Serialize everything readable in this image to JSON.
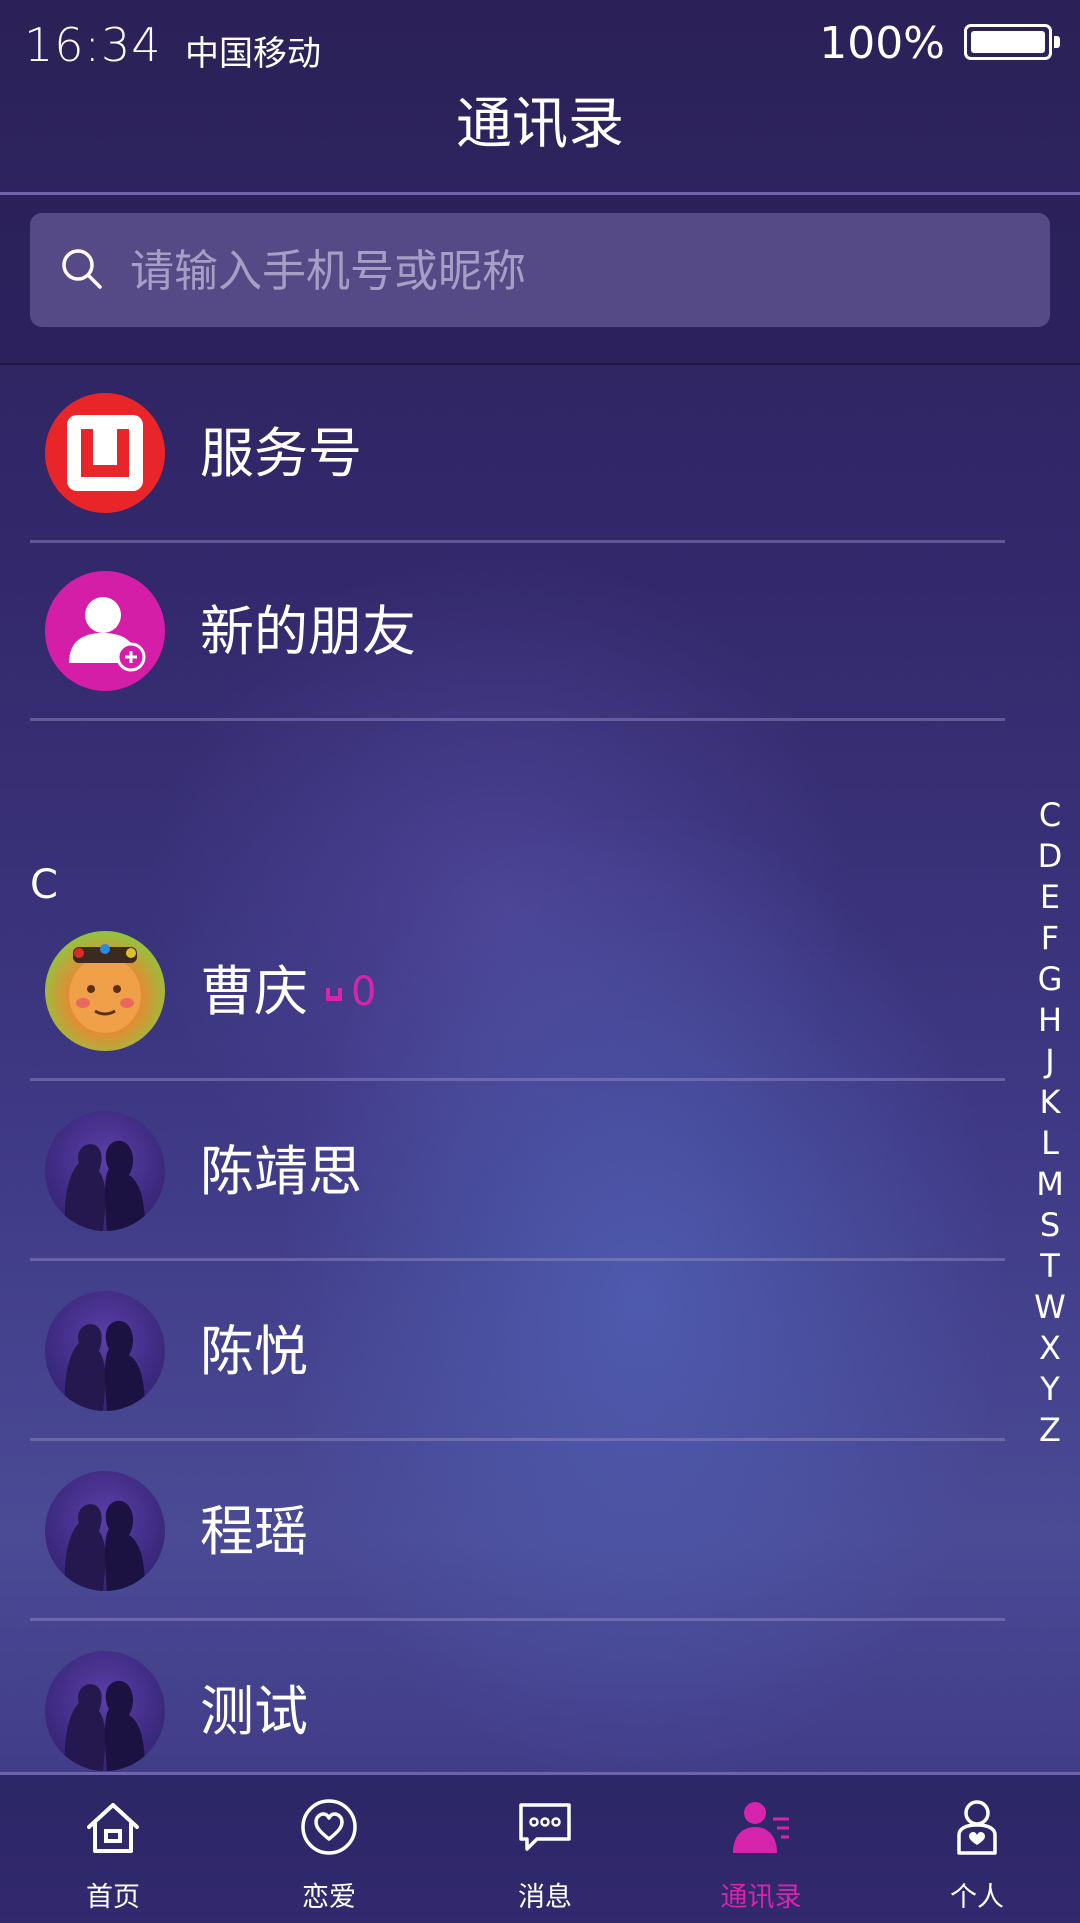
{
  "status_bar": {
    "time": "16:34",
    "carrier": "中国移动",
    "battery": "100%"
  },
  "header": {
    "title": "通讯录"
  },
  "search": {
    "placeholder": "请输入手机号或昵称"
  },
  "fixed_items": [
    {
      "label": "服务号",
      "icon": "service-account-icon",
      "color": "#e02020"
    },
    {
      "label": "新的朋友",
      "icon": "new-friend-icon",
      "color": "#d41ea8"
    }
  ],
  "section": {
    "letter": "C"
  },
  "contacts": [
    {
      "name": "曹庆",
      "badge": "0",
      "avatar": "cartoon-avatar"
    },
    {
      "name": "陈靖思",
      "avatar": "default-couple-avatar"
    },
    {
      "name": "陈悦",
      "avatar": "default-couple-avatar"
    },
    {
      "name": "程瑶",
      "avatar": "default-couple-avatar"
    },
    {
      "name": "测试",
      "avatar": "default-couple-avatar"
    }
  ],
  "alphabet_index": [
    "C",
    "D",
    "E",
    "F",
    "G",
    "H",
    "J",
    "K",
    "L",
    "M",
    "S",
    "T",
    "W",
    "X",
    "Y",
    "Z"
  ],
  "tabs": [
    {
      "label": "首页",
      "icon": "home-icon",
      "active": false
    },
    {
      "label": "恋爱",
      "icon": "heart-icon",
      "active": false
    },
    {
      "label": "消息",
      "icon": "message-icon",
      "active": false
    },
    {
      "label": "通讯录",
      "icon": "contacts-icon",
      "active": true
    },
    {
      "label": "个人",
      "icon": "profile-icon",
      "active": false
    }
  ],
  "colors": {
    "accent": "#d624ad",
    "service_red": "#e02020",
    "background": "#33286b"
  }
}
